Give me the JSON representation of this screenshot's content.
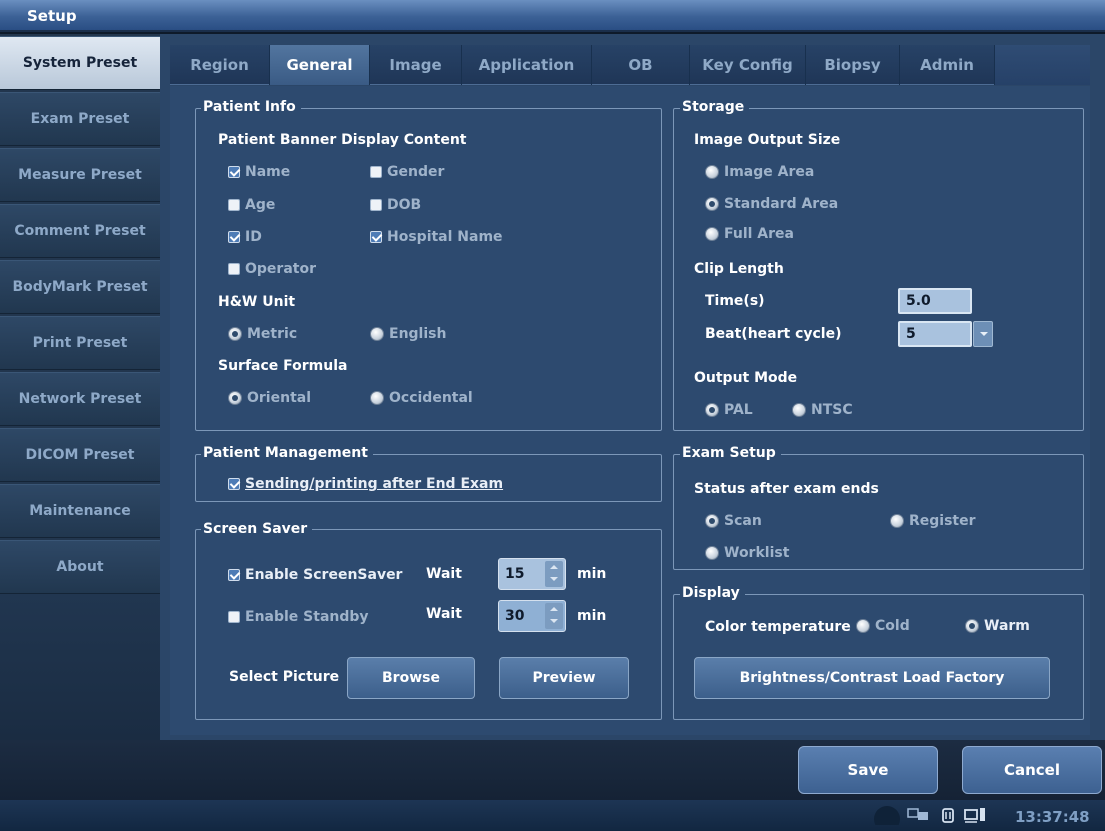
{
  "window": {
    "title": "Setup"
  },
  "sidebar": {
    "items": [
      {
        "label": "System Preset",
        "active": true
      },
      {
        "label": "Exam Preset"
      },
      {
        "label": "Measure Preset"
      },
      {
        "label": "Comment Preset"
      },
      {
        "label": "BodyMark Preset"
      },
      {
        "label": "Print Preset"
      },
      {
        "label": "Network Preset"
      },
      {
        "label": "DICOM Preset"
      },
      {
        "label": "Maintenance"
      },
      {
        "label": "About"
      }
    ]
  },
  "tabs": [
    {
      "label": "Region"
    },
    {
      "label": "General",
      "active": true
    },
    {
      "label": "Image"
    },
    {
      "label": "Application"
    },
    {
      "label": "OB"
    },
    {
      "label": "Key Config"
    },
    {
      "label": "Biopsy"
    },
    {
      "label": "Admin"
    }
  ],
  "patient_info": {
    "title": "Patient Info",
    "banner_title": "Patient Banner Display Content",
    "name": {
      "label": "Name",
      "checked": true
    },
    "gender": {
      "label": "Gender",
      "checked": false
    },
    "age": {
      "label": "Age",
      "checked": false
    },
    "dob": {
      "label": "DOB",
      "checked": false
    },
    "id": {
      "label": "ID",
      "checked": true
    },
    "hospital_name": {
      "label": "Hospital Name",
      "checked": true
    },
    "operator": {
      "label": "Operator",
      "checked": false
    },
    "hw_unit_title": "H&W Unit",
    "metric": {
      "label": "Metric",
      "selected": true
    },
    "english": {
      "label": "English",
      "selected": false
    },
    "surface_title": "Surface Formula",
    "oriental": {
      "label": "Oriental",
      "selected": true
    },
    "occidental": {
      "label": "Occidental",
      "selected": false
    }
  },
  "patient_management": {
    "title": "Patient Management",
    "sending": {
      "label": "Sending/printing after End Exam",
      "checked": true
    }
  },
  "screen_saver": {
    "title": "Screen Saver",
    "enable_screensaver": {
      "label": "Enable ScreenSaver",
      "checked": true
    },
    "wait_label_1": "Wait",
    "wait_value_1": "15",
    "min_label_1": "min",
    "enable_standby": {
      "label": "Enable Standby",
      "checked": false
    },
    "wait_label_2": "Wait",
    "wait_value_2": "30",
    "min_label_2": "min",
    "select_picture": "Select Picture",
    "browse": "Browse",
    "preview": "Preview"
  },
  "storage": {
    "title": "Storage",
    "output_size_title": "Image Output Size",
    "image_area": {
      "label": "Image Area",
      "selected": false
    },
    "standard_area": {
      "label": "Standard Area",
      "selected": true
    },
    "full_area": {
      "label": "Full Area",
      "selected": false
    },
    "clip_length_title": "Clip Length",
    "time_label": "Time(s)",
    "time_value": "5.0",
    "beat_label": "Beat(heart cycle)",
    "beat_value": "5",
    "output_mode_title": "Output Mode",
    "pal": {
      "label": "PAL",
      "selected": true
    },
    "ntsc": {
      "label": "NTSC",
      "selected": false
    }
  },
  "exam_setup": {
    "title": "Exam Setup",
    "status_title": "Status after exam ends",
    "scan": {
      "label": "Scan",
      "selected": true
    },
    "register": {
      "label": "Register",
      "selected": false
    },
    "worklist": {
      "label": "Worklist",
      "selected": false
    }
  },
  "display": {
    "title": "Display",
    "color_temp_label": "Color temperature",
    "cold": {
      "label": "Cold",
      "selected": false
    },
    "warm": {
      "label": "Warm",
      "selected": true
    },
    "brightness_button": "Brightness/Contrast Load Factory"
  },
  "footer": {
    "save": "Save",
    "cancel": "Cancel"
  },
  "status": {
    "clock": "13:37:48"
  }
}
